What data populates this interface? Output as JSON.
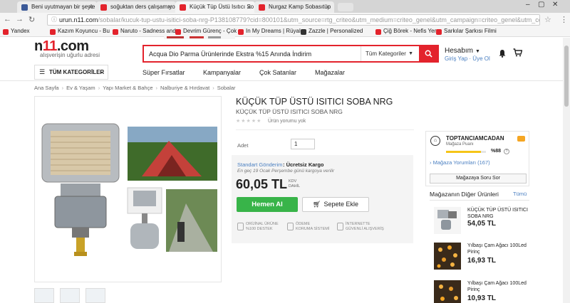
{
  "browser": {
    "tabs": [
      {
        "title": "Beni uyutmayan bir şeyle",
        "icon_color": "#3b5998"
      },
      {
        "title": "soğuktan ders çalışamıyo",
        "icon_color": "#e3232c"
      },
      {
        "title": "Küçük Tüp Üstü Isıtıcı So",
        "icon_color": "#e3232c"
      },
      {
        "title": "Nurgaz Kamp Sobasıtüp",
        "icon_color": "#e3232c"
      }
    ],
    "url_host": "urun.n11.com",
    "url_rest": "/sobalar/kucuk-tup-ustu-isitici-soba-nrg-P138108779?cid=800101&utm_source=rtg_criteo&utm_medium=criteo_genel&utm_campaign=criteo_genel&utm_content=103_219_3161&utm_",
    "bookmarks": [
      {
        "label": "Yandex",
        "color": "#e3232c"
      },
      {
        "label": "Kazım Koyuncu - Bu",
        "color": "#e3232c"
      },
      {
        "label": "Naruto - Sadness and",
        "color": "#e3232c"
      },
      {
        "label": "Devrim Gürenç - Çok",
        "color": "#e3232c"
      },
      {
        "label": "In My Dreams | Rüyal",
        "color": "#e3232c"
      },
      {
        "label": "Zazzle | Personalized",
        "color": "#333333"
      },
      {
        "label": "Çiğ Börek - Nefis Yem",
        "color": "#e3232c"
      },
      {
        "label": "Sarkılar Şarkısı Filmi",
        "color": "#e3232c"
      }
    ]
  },
  "header": {
    "logo_main": "n",
    "logo_accent": "11",
    "logo_suffix": ".com",
    "tagline": "alışverişin uğurlu adresi",
    "search_value": "Acqua Dio Parma Ürünlerinde Ekstra %15 Anında İndirim",
    "search_category": "Tüm Kategoriler",
    "account_label": "Hesabım",
    "login_link": "Giriş Yap",
    "signup_link": "Üye Ol"
  },
  "nav": {
    "all_categories": "TÜM KATEGORİLER",
    "links": [
      "Süper Fırsatlar",
      "Kampanyalar",
      "Çok Satanlar",
      "Mağazalar"
    ]
  },
  "breadcrumb": [
    "Ana Sayfa",
    "Ev & Yaşam",
    "Yapı Market & Bahçe",
    "Nalburiye & Hırdavat",
    "Sobalar"
  ],
  "product": {
    "title": "KÜÇÜK TÜP ÜSTÜ ISITICI SOBA NRG",
    "subtitle": "KÜÇÜK TÜP ÜSTÜ ISITICI SOBA NRG",
    "rating_stars": 0,
    "no_review": "Ürün yorumu yok",
    "quantity_label": "Adet",
    "quantity": "1",
    "shipping_label": "Standart Gönderim",
    "shipping_value": ": Ücretsiz Kargo",
    "shipping_date": "En geç 19 Ocak Perşembe günü kargoya verilir",
    "price": "60,05 TL",
    "kdv_1": "KDV",
    "kdv_2": "DAHİL",
    "buy_button": "Hemen Al",
    "cart_button": "Sepete Ekle",
    "badges": [
      {
        "l1": "ORİJİNAL ÜRÜNE",
        "l2": "%100 DESTEK"
      },
      {
        "l1": "ÖDEME",
        "l2": "KORUMA SİSTEMİ"
      },
      {
        "l1": "İNTERNETTE",
        "l2": "GÜVENLİ ALIŞVERİŞ"
      }
    ]
  },
  "seller": {
    "name": "TOPTANCIAMCADAN",
    "score_label": "Mağaza Puanı",
    "score": "%88",
    "score_fraction": 0.88,
    "reviews_link": "Mağaza Yorumları (167)",
    "ask_button": "Mağazaya Soru Sor",
    "other_header": "Mağazanın Diğer Ürünleri",
    "other_all": "Tümü",
    "other_items": [
      {
        "name": "KÜÇÜK TÜP ÜSTÜ ISITICI SOBA NRG",
        "price": "54,05 TL"
      },
      {
        "name": "Yılbaşı Çam Ağacı 100Led Pirinç",
        "price": "16,93 TL"
      },
      {
        "name": "Yılbaşı Çam Ağacı 100Led Pirinç",
        "price": "10,93 TL"
      }
    ]
  },
  "colors": {
    "brand_red": "#e3232c",
    "buy_green": "#38b449",
    "link_blue": "#4a7fc1"
  }
}
